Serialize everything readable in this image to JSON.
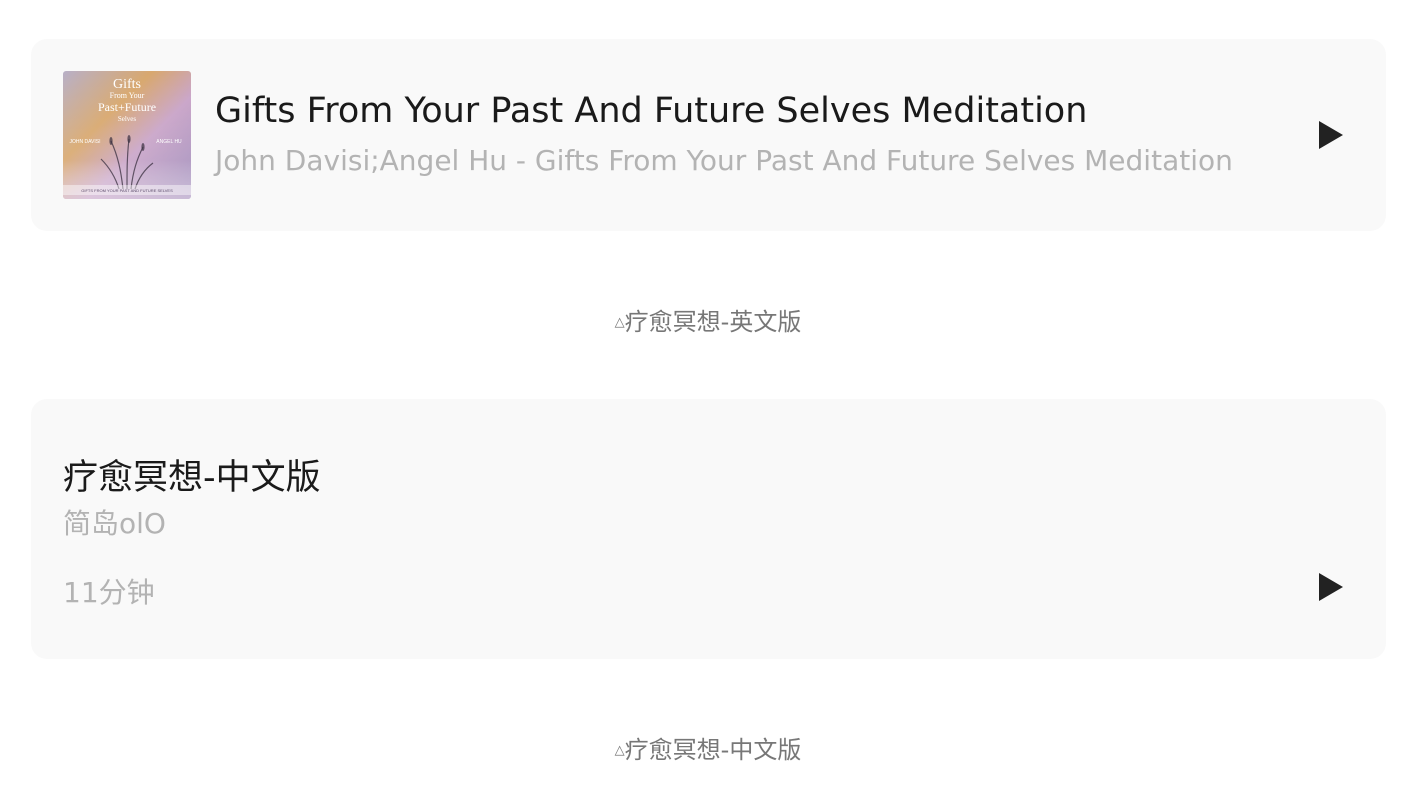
{
  "tracks": [
    {
      "title": "Gifts From Your Past And Future Selves Meditation",
      "subtitle": "John Davisi;Angel Hu - Gifts From Your Past And Future Selves Meditation",
      "cover": {
        "line1": "Gifts",
        "line2": "From Your",
        "line3": "Past+Future",
        "line4": "Selves",
        "left_name": "JOHN DAVISI",
        "right_name": "ANGEL HU",
        "bottom": "GIFTS FROM YOUR PAST AND FUTURE SELVES"
      },
      "play_icon": "play-icon"
    },
    {
      "title": "疗愈冥想-中文版",
      "subtitle": "简岛olO",
      "duration": "11分钟",
      "play_icon": "play-icon"
    }
  ],
  "captions": [
    {
      "marker": "△",
      "text": "疗愈冥想-英文版"
    },
    {
      "marker": "△",
      "text": "疗愈冥想-中文版"
    }
  ],
  "colors": {
    "card_bg": "#f9f9f9",
    "title": "#1a1a1a",
    "subtitle": "#b3b3b3",
    "caption": "#777777",
    "play": "#222222"
  }
}
